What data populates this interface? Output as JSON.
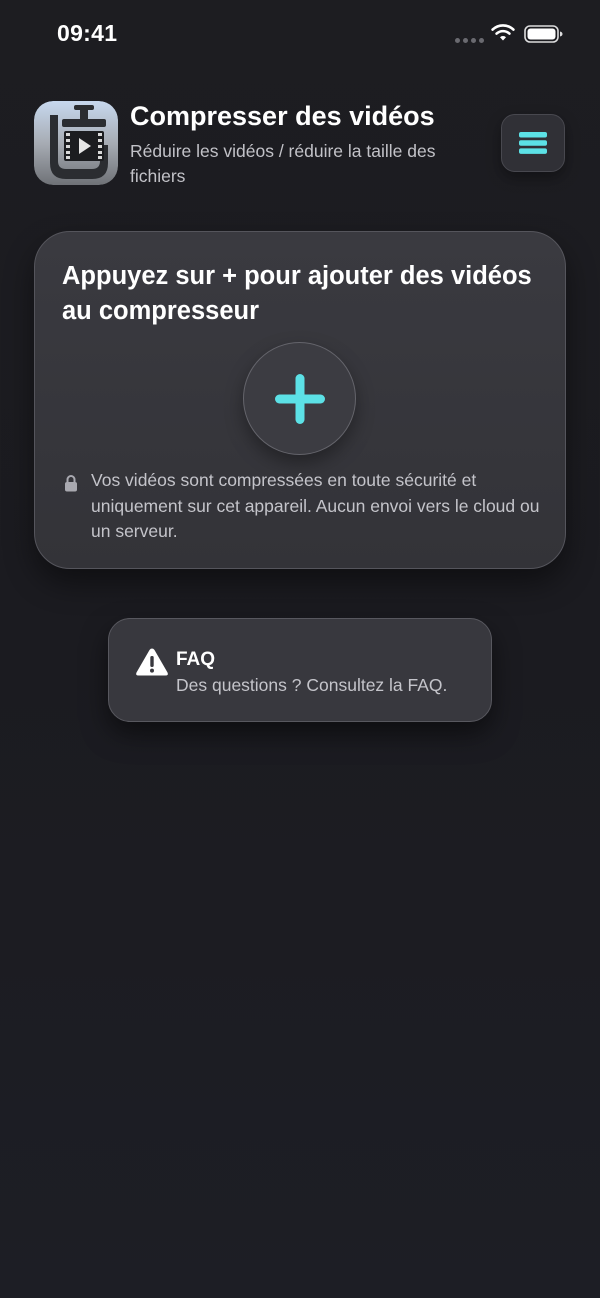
{
  "status_bar": {
    "time": "09:41",
    "signal_icon": "signal-dots-icon",
    "wifi_icon": "wifi-icon",
    "battery_icon": "battery-icon"
  },
  "header": {
    "app_icon": "video-compress-app-icon",
    "title": "Compresser des vidéos",
    "subtitle": "Réduire les vidéos / réduire la taille des fichiers",
    "menu_icon": "menu-icon"
  },
  "add_card": {
    "title": "Appuyez sur + pour ajouter des vidéos au compresseur",
    "add_icon": "plus-icon",
    "lock_icon": "lock-icon",
    "privacy_note": "Vos vidéos sont compressées en toute sécurité et uniquement sur cet appareil. Aucun envoi vers le cloud ou un serveur."
  },
  "faq": {
    "icon": "warning-icon",
    "title": "FAQ",
    "subtitle": "Des questions ? Consultez la FAQ."
  },
  "colors": {
    "accent": "#5ce1e6",
    "background": "#1c1c21",
    "card": "#36363c"
  }
}
